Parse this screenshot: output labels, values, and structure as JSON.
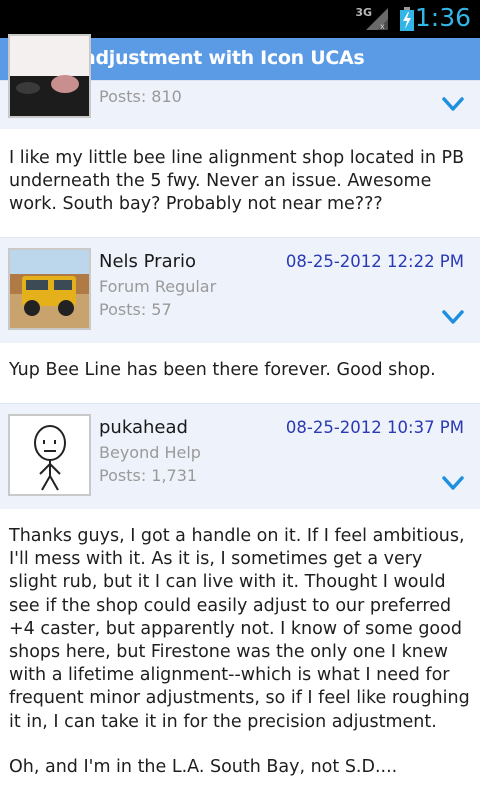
{
  "status_bar": {
    "network": "3G",
    "time": "1:36",
    "icons": [
      "signal-icon",
      "battery-charging-icon"
    ]
  },
  "title_bar": {
    "title": "Caster adjustment with Icon UCAs"
  },
  "colors": {
    "accent": "#33b5e5",
    "title_bar": "#5b9be6",
    "post_header_bg": "#eef2fb",
    "date_color": "#2a39b4"
  },
  "posts": [
    {
      "posts_count": "Posts: 810",
      "body": "I like my little bee line alignment shop located in PB underneath the 5 fwy. Never an issue. Awesome work. South bay? Probably not near me???"
    },
    {
      "username": "Nels Prario",
      "role": "Forum Regular",
      "posts_count": "Posts: 57",
      "date": "08-25-2012 12:22 PM",
      "body": "Yup Bee Line has been there forever. Good shop."
    },
    {
      "username": "pukahead",
      "role": "Beyond Help",
      "posts_count": "Posts: 1,731",
      "date": "08-25-2012 10:37 PM",
      "body": "Thanks guys, I got a handle on it. If I feel ambitious, I'll mess with it. As it is, I sometimes get a very slight rub, but it I can live with it. Thought I would see if the shop could easily adjust to our preferred +4 caster, but apparently not. I know of some good shops here, but Firestone was the only one I knew with a lifetime alignment--which is what I need for frequent minor adjustments, so if I feel like roughing it in, I can take it in for the precision adjustment.",
      "body2": "Oh, and I'm in the L.A. South Bay, not S.D...."
    }
  ]
}
